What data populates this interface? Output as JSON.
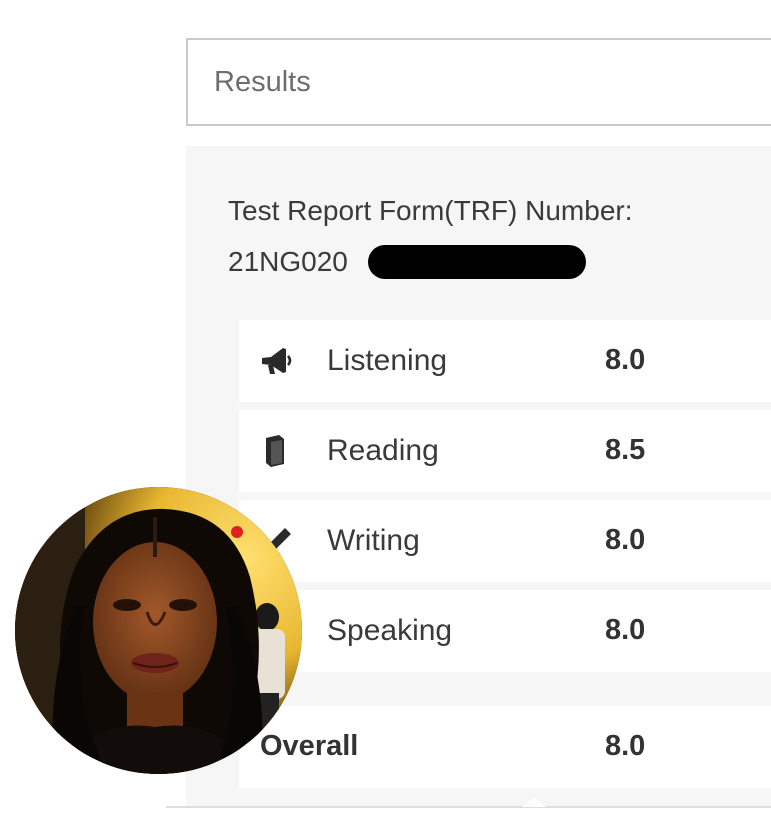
{
  "header": {
    "title": "Results"
  },
  "trf": {
    "label": "Test Report Form(TRF) Number:",
    "number_visible": "21NG020"
  },
  "scores": [
    {
      "name": "Listening",
      "value": "8.0",
      "icon": "megaphone-icon"
    },
    {
      "name": "Reading",
      "value": "8.5",
      "icon": "book-icon"
    },
    {
      "name": "Writing",
      "value": "8.0",
      "icon": "pen-icon"
    },
    {
      "name": "Speaking",
      "value": "8.0",
      "icon": "speech-icon"
    }
  ],
  "overall": {
    "label": "Overall",
    "value": "8.0"
  },
  "colors": {
    "panel_bg": "#f5f6f5",
    "row_bg": "#ffffff",
    "header_border": "#c9c9c9",
    "redaction": "#000000"
  }
}
